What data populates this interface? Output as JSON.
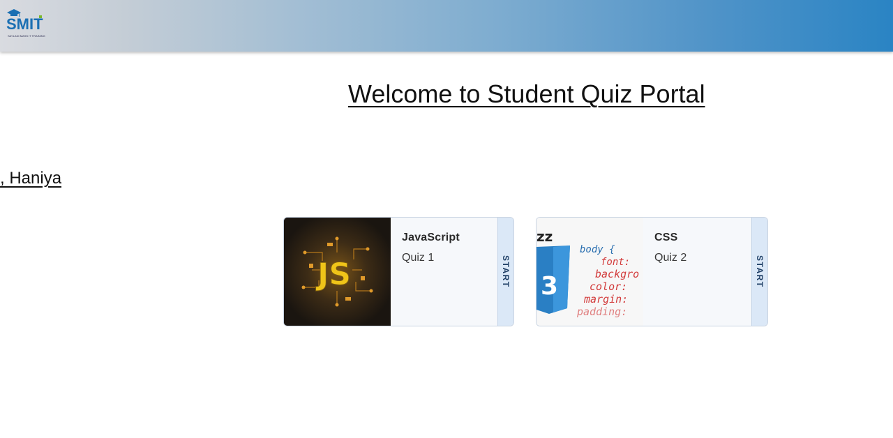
{
  "header": {
    "logo_text": "SMIT",
    "logo_tagline": "SAYLANI MASS IT TRAINING"
  },
  "main": {
    "title": "Welcome to Student Quiz Portal",
    "greeting": ", Haniya"
  },
  "quizzes": [
    {
      "title": "JavaScript",
      "subtitle": "Quiz 1",
      "action": "START",
      "image_label": "JS"
    },
    {
      "title": "CSS",
      "subtitle": "Quiz 2",
      "action": "START",
      "image_label": "CSS code"
    }
  ],
  "css_code_lines": [
    "body {",
    "font: ",
    "backgro",
    "color: ",
    "margin: ",
    "padding: "
  ],
  "colors": {
    "header_gradient_start": "#d9dbe0",
    "header_gradient_end": "#2a84c4",
    "start_strip": "#dbe8f7",
    "js_yellow": "#f0c419",
    "css_blue": "#2a7fc4"
  }
}
